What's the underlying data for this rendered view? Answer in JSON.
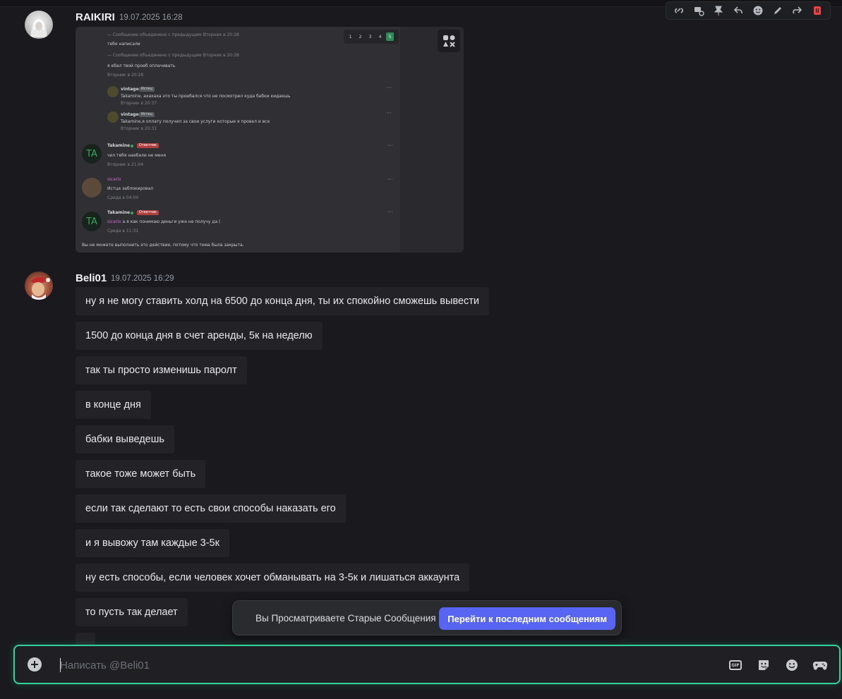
{
  "messages": [
    {
      "author": "RAIKIRI",
      "timestamp": "19.07.2025 16:28"
    },
    {
      "author": "Beli01",
      "timestamp": "19.07.2025 16:29",
      "lines": [
        "ну я не могу ставить холд на 6500 до конца дня, ты их спокойно сможешь вывести",
        "1500 до конца дня в счет аренды, 5к на неделю",
        "так ты просто изменишь паролт",
        "в конце дня",
        "бабки выведешь",
        "такое тоже может быть",
        "если так сделают то есть свои способы наказать его",
        "и я вывожу там каждые 3-5к",
        "ну есть способы, если человек хочет обманывать на 3-5к и лишаться аккаунта",
        "то пусть так делает"
      ]
    }
  ],
  "embedded_screenshot": {
    "pages": [
      "1",
      "2",
      "3",
      "4",
      "5"
    ],
    "active_page": "5",
    "merged_note_1": "— Сообщение объединено с предыдущим Вторник в 20:28",
    "line_1": "тебе написали",
    "merged_note_2": "— Сообщение объединено с предыдущим Вторник в 20:28",
    "line_2": "я ебал твой проеб оплачивать",
    "time_1": "Вторник в 20:28",
    "reply_1_name": "vintageo",
    "reply_1_tag": "Истец",
    "reply_1_text": "Takamine, ахахаха это ты проебался что не посмотрел куда бабки кидаешь",
    "reply_1_time": "Вторник в 20:37",
    "reply_2_name": "vintageo",
    "reply_2_tag": "Истец",
    "reply_2_text": "Takamine,я оплату получил за свои услуги которые я провел и все",
    "reply_2_time": "Вторник в 20:31",
    "ta_initials": "TA",
    "ta_name": "Takamine",
    "ta_tag": "Ответчик",
    "ta_text_1": "чел тебя наебали не меня",
    "ta_time_1": "Вторник в 21:04",
    "sicario_name": "sicario",
    "sicario_text": "Истца заблокировал",
    "sicario_time": "Среда в 04:00",
    "ta_text_2_mention": "sicario",
    "ta_text_2": " а я как понимаю деньги уже не получу да (",
    "ta_time_2": "Среда в 11:31",
    "closed_note": "Вы не можете выполнить это действие, потому что тема была закрыта."
  },
  "old_messages_bar": {
    "text": "Вы Просматриваете Старые Сообщения",
    "button": "Перейти к последним сообщениям"
  },
  "composer": {
    "placeholder": "Написать @Beli01",
    "gif_label": "GIF"
  },
  "colors": {
    "accent": "#5865f2",
    "composer_border": "#2fd49a",
    "delete": "#f23f42"
  }
}
